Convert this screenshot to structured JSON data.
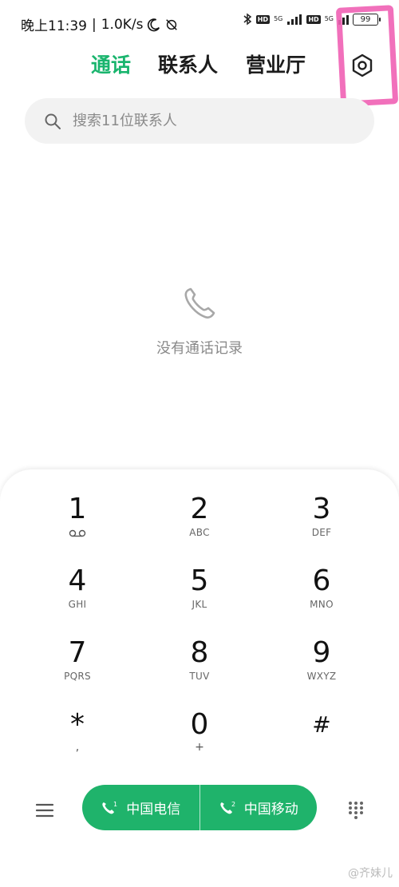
{
  "status_bar": {
    "time": "晚上11:39",
    "speed": "1.0K/s",
    "hd": "HD",
    "net": "5G",
    "battery": "99"
  },
  "tabs": [
    {
      "label": "通话",
      "active": true
    },
    {
      "label": "联系人",
      "active": false
    },
    {
      "label": "营业厅",
      "active": false
    }
  ],
  "search": {
    "placeholder": "搜索11位联系人"
  },
  "empty_state": {
    "text": "没有通话记录"
  },
  "keys": [
    {
      "digit": "1",
      "letters": ""
    },
    {
      "digit": "2",
      "letters": "ABC"
    },
    {
      "digit": "3",
      "letters": "DEF"
    },
    {
      "digit": "4",
      "letters": "GHI"
    },
    {
      "digit": "5",
      "letters": "JKL"
    },
    {
      "digit": "6",
      "letters": "MNO"
    },
    {
      "digit": "7",
      "letters": "PQRS"
    },
    {
      "digit": "8",
      "letters": "TUV"
    },
    {
      "digit": "9",
      "letters": "WXYZ"
    },
    {
      "digit": "*",
      "letters": ","
    },
    {
      "digit": "0",
      "letters": "+"
    },
    {
      "digit": "#",
      "letters": ""
    }
  ],
  "call_buttons": [
    {
      "sim": "1",
      "label": "中国电信"
    },
    {
      "sim": "2",
      "label": "中国移动"
    }
  ],
  "watermark": "@齐妹儿",
  "colors": {
    "accent": "#1ab56e",
    "call_bar": "#1fb36b",
    "highlight": "#f060b4"
  },
  "icons": [
    "moon-icon",
    "alarm-off-icon",
    "bluetooth-icon",
    "signal-icon",
    "battery-icon",
    "settings-icon",
    "search-icon",
    "phone-icon",
    "voicemail-icon",
    "menu-icon",
    "dialpad-icon"
  ]
}
